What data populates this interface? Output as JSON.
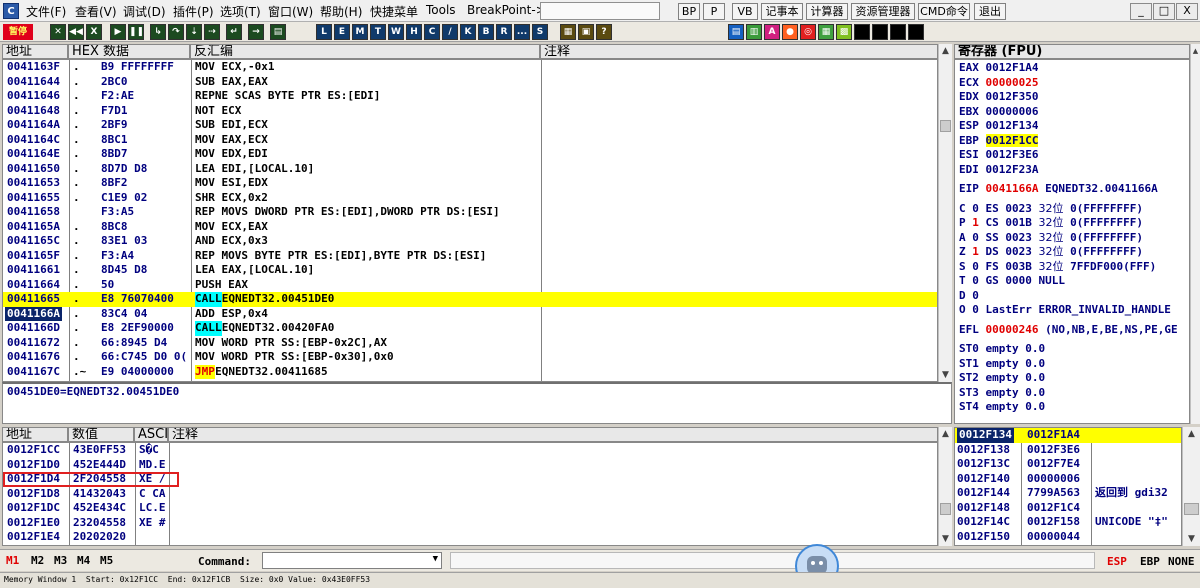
{
  "menubar": {
    "items": [
      "文件(F)",
      "查看(V)",
      "调试(D)",
      "插件(P)",
      "选项(T)",
      "窗口(W)",
      "帮助(H)",
      "快捷菜单",
      "Tools",
      "BreakPoint->"
    ],
    "right_buttons": [
      "BP",
      "P",
      "VB",
      "记事本",
      "计算器",
      "资源管理器",
      "CMD命令",
      "退出"
    ],
    "window_buttons": [
      "_",
      "□",
      "X"
    ]
  },
  "toolbar": {
    "status": "暂停",
    "letters": [
      "L",
      "E",
      "M",
      "T",
      "W",
      "H",
      "C",
      "/",
      "K",
      "B",
      "R",
      "...",
      "S"
    ]
  },
  "disasm": {
    "headers": {
      "addr": "地址",
      "hex": "HEX 数据",
      "disasm": "反汇编",
      "comment": "注释"
    },
    "rows": [
      {
        "addr": "0041163F",
        "m": ".",
        "hex": "B9 FFFFFFFF",
        "asm": "MOV ECX,-0x1"
      },
      {
        "addr": "00411644",
        "m": ".",
        "hex": "2BC0",
        "asm": "SUB EAX,EAX"
      },
      {
        "addr": "00411646",
        "m": ".",
        "hex": "F2:AE",
        "asm": "REPNE SCAS BYTE PTR ES:[EDI]"
      },
      {
        "addr": "00411648",
        "m": ".",
        "hex": "F7D1",
        "asm": "NOT ECX"
      },
      {
        "addr": "0041164A",
        "m": ".",
        "hex": "2BF9",
        "asm": "SUB EDI,ECX"
      },
      {
        "addr": "0041164C",
        "m": ".",
        "hex": "8BC1",
        "asm": "MOV EAX,ECX"
      },
      {
        "addr": "0041164E",
        "m": ".",
        "hex": "8BD7",
        "asm": "MOV EDX,EDI"
      },
      {
        "addr": "00411650",
        "m": ".",
        "hex": "8D7D D8",
        "asm": "LEA EDI,[LOCAL.10]"
      },
      {
        "addr": "00411653",
        "m": ".",
        "hex": "8BF2",
        "asm": "MOV ESI,EDX"
      },
      {
        "addr": "00411655",
        "m": ".",
        "hex": "C1E9 02",
        "asm": "SHR ECX,0x2"
      },
      {
        "addr": "00411658",
        "m": "",
        "hex": "F3:A5",
        "asm": "REP MOVS DWORD PTR ES:[EDI],DWORD PTR DS:[ESI]"
      },
      {
        "addr": "0041165A",
        "m": ".",
        "hex": "8BC8",
        "asm": "MOV ECX,EAX"
      },
      {
        "addr": "0041165C",
        "m": ".",
        "hex": "83E1 03",
        "asm": "AND ECX,0x3"
      },
      {
        "addr": "0041165F",
        "m": ".",
        "hex": "F3:A4",
        "asm": "REP MOVS BYTE PTR ES:[EDI],BYTE PTR DS:[ESI]"
      },
      {
        "addr": "00411661",
        "m": ".",
        "hex": "8D45 D8",
        "asm": "LEA EAX,[LOCAL.10]"
      },
      {
        "addr": "00411664",
        "m": ".",
        "hex": "50",
        "asm": "PUSH EAX"
      },
      {
        "addr": "00411665",
        "m": ".",
        "hex": "E8 76070400",
        "kw": "CALL",
        "asm": " EQNEDT32.00451DE0",
        "style": "hl"
      },
      {
        "addr": "0041166A",
        "m": ".",
        "hex": "83C4 04",
        "asm": "ADD ESP,0x4",
        "style": "cur"
      },
      {
        "addr": "0041166D",
        "m": ".",
        "hex": "E8 2EF90000",
        "kw": "CALL",
        "asm": " EQNEDT32.00420FA0"
      },
      {
        "addr": "00411672",
        "m": ".",
        "hex": "66:8945 D4",
        "asm": "MOV WORD PTR SS:[EBP-0x2C],AX"
      },
      {
        "addr": "00411676",
        "m": ".",
        "hex": "66:C745 D0 0(",
        "asm": "MOV WORD PTR SS:[EBP-0x30],0x0"
      },
      {
        "addr": "0041167C",
        "m": ".~",
        "hex": "E9 04000000",
        "kw": "JMP",
        "asm": " EQNEDT32.00411685"
      }
    ],
    "info": "00451DE0=EQNEDT32.00451DE0"
  },
  "registers": {
    "title": "寄存器 (FPU)",
    "gp": [
      {
        "n": "EAX",
        "v": "0012F1A4"
      },
      {
        "n": "ECX",
        "v": "00000025",
        "c": "red"
      },
      {
        "n": "EDX",
        "v": "0012F350"
      },
      {
        "n": "EBX",
        "v": "00000006"
      },
      {
        "n": "ESP",
        "v": "0012F134"
      },
      {
        "n": "EBP",
        "v": "0012F1CC",
        "c": "hl"
      },
      {
        "n": "ESI",
        "v": "0012F3E6"
      },
      {
        "n": "EDI",
        "v": "0012F23A"
      }
    ],
    "eip": {
      "n": "EIP",
      "v": "0041166A",
      "sym": "EQNEDT32.0041166A"
    },
    "flags": [
      {
        "f": "C",
        "v": "0",
        "seg": "ES",
        "sel": "0023",
        "bits": "32位",
        "base": "0(FFFFFFFF)"
      },
      {
        "f": "P",
        "v": "1",
        "seg": "CS",
        "sel": "001B",
        "bits": "32位",
        "base": "0(FFFFFFFF)",
        "c": "red"
      },
      {
        "f": "A",
        "v": "0",
        "seg": "SS",
        "sel": "0023",
        "bits": "32位",
        "base": "0(FFFFFFFF)"
      },
      {
        "f": "Z",
        "v": "1",
        "seg": "DS",
        "sel": "0023",
        "bits": "32位",
        "base": "0(FFFFFFFF)",
        "c": "red"
      },
      {
        "f": "S",
        "v": "0",
        "seg": "FS",
        "sel": "003B",
        "bits": "32位",
        "base": "7FFDF000(FFF)"
      },
      {
        "f": "T",
        "v": "0",
        "seg": "GS",
        "sel": "0000",
        "bits": "",
        "base": "NULL"
      },
      {
        "f": "D",
        "v": "0",
        "seg": "",
        "sel": "",
        "bits": "",
        "base": ""
      },
      {
        "f": "O",
        "v": "0",
        "seg": "",
        "sel": "",
        "bits": "",
        "base": "LastErr ERROR_INVALID_HANDLE"
      }
    ],
    "efl": {
      "n": "EFL",
      "v": "00000246",
      "desc": "(NO,NB,E,BE,NS,PE,GE"
    },
    "fpu": [
      "ST0 empty 0.0",
      "ST1 empty 0.0",
      "ST2 empty 0.0",
      "ST3 empty 0.0",
      "ST4 empty 0.0"
    ]
  },
  "dump": {
    "headers": {
      "addr": "地址",
      "val": "数值",
      "ascii": "ASCI",
      "comment": "注释"
    },
    "rows": [
      {
        "addr": "0012F1CC",
        "val": "43E0FF53",
        "ascii": "S�C"
      },
      {
        "addr": "0012F1D0",
        "val": "452E444D",
        "ascii": "MD.E"
      },
      {
        "addr": "0012F1D4",
        "val": "2F204558",
        "ascii": "XE /",
        "boxed": true
      },
      {
        "addr": "0012F1D8",
        "val": "41432043",
        "ascii": "C CA"
      },
      {
        "addr": "0012F1DC",
        "val": "452E434C",
        "ascii": "LC.E"
      },
      {
        "addr": "0012F1E0",
        "val": "23204558",
        "ascii": "XE #"
      },
      {
        "addr": "0012F1E4",
        "val": "20202020",
        "ascii": ""
      }
    ]
  },
  "stack": {
    "rows": [
      {
        "addr": "0012F134",
        "val": "0012F1A4",
        "note": "",
        "sel": true
      },
      {
        "addr": "0012F138",
        "val": "0012F3E6",
        "note": ""
      },
      {
        "addr": "0012F13C",
        "val": "0012F7E4",
        "note": ""
      },
      {
        "addr": "0012F140",
        "val": "00000006",
        "note": ""
      },
      {
        "addr": "0012F144",
        "val": "7799A563",
        "note": "返回到 gdi32"
      },
      {
        "addr": "0012F148",
        "val": "0012F1C4",
        "note": ""
      },
      {
        "addr": "0012F14C",
        "val": "0012F158",
        "note": "UNICODE \"‡\""
      },
      {
        "addr": "0012F150",
        "val": "00000044",
        "note": ""
      }
    ]
  },
  "bottombar": {
    "mem_tabs": [
      "M1",
      "M2",
      "M3",
      "M4",
      "M5"
    ],
    "command_label": "Command:",
    "right": [
      "ESP",
      "EBP",
      "NONE"
    ]
  },
  "statusbar": "Memory Window 1  Start: 0x12F1CC  End: 0x12F1CB  Size: 0x0 Value: 0x43E0FF53"
}
